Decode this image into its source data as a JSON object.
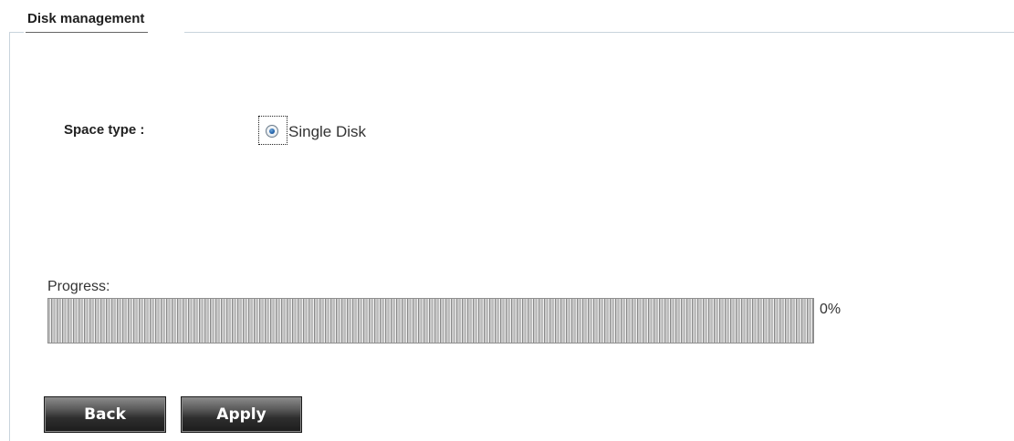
{
  "panel": {
    "title": "Disk management"
  },
  "space_type": {
    "label": "Space type :",
    "options": [
      {
        "label": "Single Disk",
        "selected": true
      }
    ]
  },
  "progress": {
    "label": "Progress:",
    "percent_text": "0%",
    "fraction": 0
  },
  "buttons": {
    "back_label": "Back",
    "apply_label": "Apply"
  }
}
